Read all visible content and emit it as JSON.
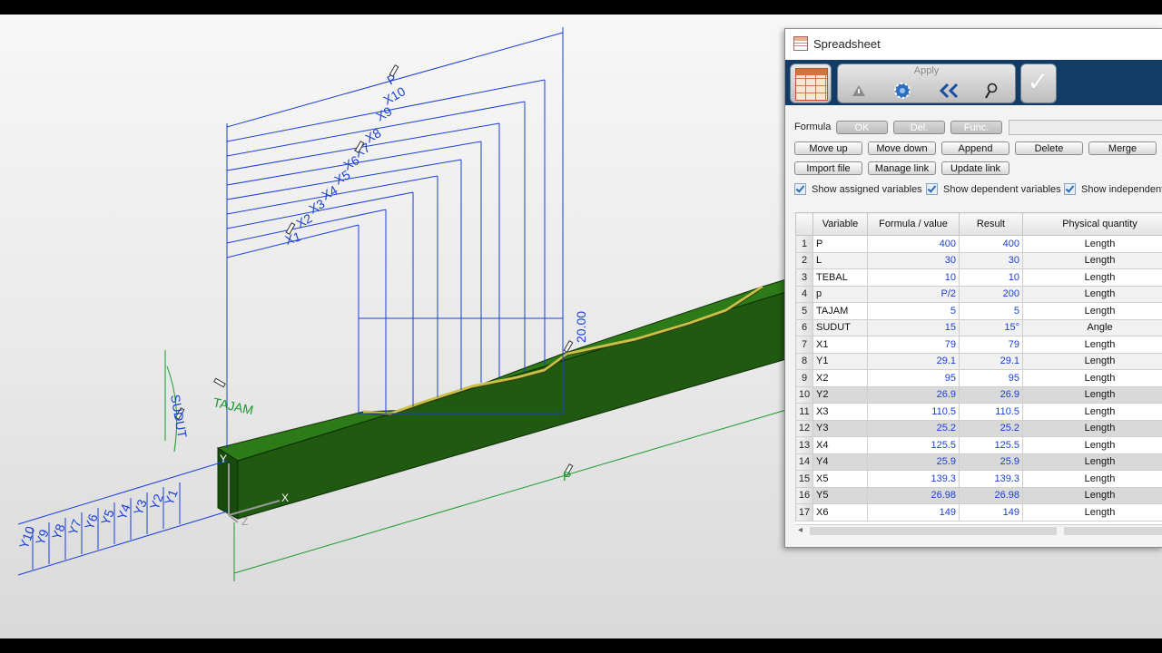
{
  "cad": {
    "dimension_labels": [
      "X1",
      "X2",
      "X3",
      "X4",
      "X5",
      "X6",
      "X7",
      "X8",
      "X9",
      "X10",
      "P"
    ],
    "left_labels": [
      "Y10",
      "Y9",
      "Y8",
      "Y7",
      "Y6",
      "Y5",
      "Y4",
      "Y3",
      "Y2",
      "Y1"
    ],
    "tajam_label": "TAJAM",
    "sudut_label": "SUDUT",
    "height_label": "20.00",
    "p_label": "P",
    "axis_x": "X",
    "axis_y": "Y",
    "axis_z": "Z",
    "colors": {
      "dimension": "#1a3fd6",
      "green_dim": "#1a9a2a",
      "solid": "#1f5a10",
      "ridge": "#b8b040"
    }
  },
  "spreadsheet": {
    "title": "Spreadsheet",
    "apply_label": "Apply",
    "formula_label": "Formula",
    "buttons_row0": [
      "OK",
      "Del.",
      "Func."
    ],
    "buttons_row1": [
      "Move up",
      "Move down",
      "Append",
      "Delete",
      "Merge"
    ],
    "buttons_row2": [
      "Import file",
      "Manage link",
      "Update link"
    ],
    "checkboxes": [
      "Show assigned variables",
      "Show dependent variables",
      "Show independent"
    ],
    "columns": [
      "Variable",
      "Formula / value",
      "Result",
      "Physical quantity"
    ],
    "rows": [
      {
        "i": "1",
        "v": "P",
        "f": "400",
        "r": "400",
        "q": "Length"
      },
      {
        "i": "2",
        "v": "L",
        "f": "30",
        "r": "30",
        "q": "Length"
      },
      {
        "i": "3",
        "v": "TEBAL",
        "f": "10",
        "r": "10",
        "q": "Length"
      },
      {
        "i": "4",
        "v": "p",
        "f": "P/2",
        "r": "200",
        "q": "Length"
      },
      {
        "i": "5",
        "v": "TAJAM",
        "f": "5",
        "r": "5",
        "q": "Length"
      },
      {
        "i": "6",
        "v": "SUDUT",
        "f": "15",
        "r": "15°",
        "q": "Angle"
      },
      {
        "i": "7",
        "v": "X1",
        "f": "79",
        "r": "79",
        "q": "Length"
      },
      {
        "i": "8",
        "v": "Y1",
        "f": "29.1",
        "r": "29.1",
        "q": "Length"
      },
      {
        "i": "9",
        "v": "X2",
        "f": "95",
        "r": "95",
        "q": "Length"
      },
      {
        "i": "10",
        "v": "Y2",
        "f": "26.9",
        "r": "26.9",
        "q": "Length"
      },
      {
        "i": "11",
        "v": "X3",
        "f": "110.5",
        "r": "110.5",
        "q": "Length"
      },
      {
        "i": "12",
        "v": "Y3",
        "f": "25.2",
        "r": "25.2",
        "q": "Length"
      },
      {
        "i": "13",
        "v": "X4",
        "f": "125.5",
        "r": "125.5",
        "q": "Length"
      },
      {
        "i": "14",
        "v": "Y4",
        "f": "25.9",
        "r": "25.9",
        "q": "Length"
      },
      {
        "i": "15",
        "v": "X5",
        "f": "139.3",
        "r": "139.3",
        "q": "Length"
      },
      {
        "i": "16",
        "v": "Y5",
        "f": "26.98",
        "r": "26.98",
        "q": "Length"
      },
      {
        "i": "17",
        "v": "X6",
        "f": "149",
        "r": "149",
        "q": "Length"
      }
    ]
  }
}
